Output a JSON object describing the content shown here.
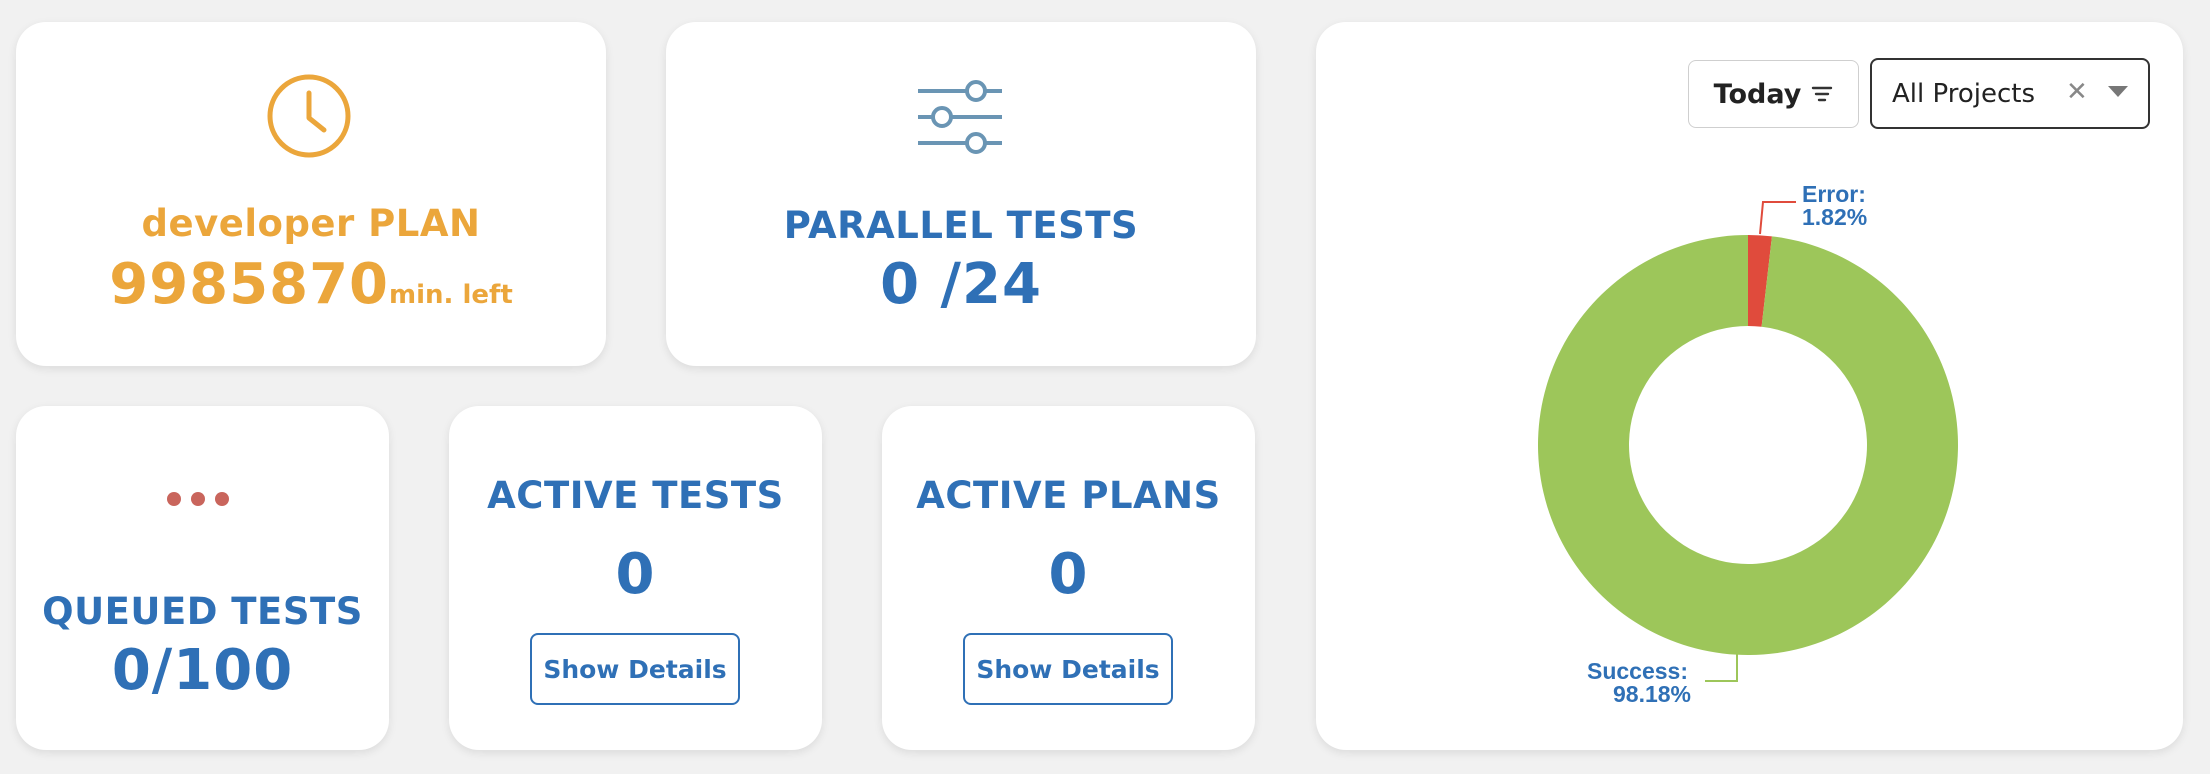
{
  "plan_card": {
    "icon": "clock-icon",
    "title": "developer PLAN",
    "minutes": "9985870",
    "unit": "min. left",
    "color": "#eba63b"
  },
  "parallel_card": {
    "icon": "sliders-icon",
    "title": "PARALLEL TESTS",
    "value": "0 /24"
  },
  "queued_card": {
    "icon": "dots-icon",
    "title": "QUEUED TESTS",
    "value": "0/100",
    "dot_color": "#c9655c"
  },
  "active_tests_card": {
    "title": "ACTIVE TESTS",
    "value": "0",
    "button": "Show Details"
  },
  "active_plans_card": {
    "title": "ACTIVE PLANS",
    "value": "0",
    "button": "Show Details"
  },
  "filters": {
    "period": "Today",
    "period_icon": "filter-icon",
    "project": "All Projects",
    "clear_icon": "close-icon",
    "dropdown_icon": "chevron-down-icon"
  },
  "chart_data": {
    "type": "pie",
    "categories": [
      "Error",
      "Success"
    ],
    "values": [
      1.82,
      98.18
    ],
    "labels": [
      "Error:",
      "Success:"
    ],
    "value_labels": [
      "1.82%",
      "98.18%"
    ],
    "colors": [
      "#e04b3c",
      "#9dc65a"
    ],
    "title": ""
  },
  "colors": {
    "accent_blue": "#2f70b6",
    "background": "#f1f1f1"
  }
}
